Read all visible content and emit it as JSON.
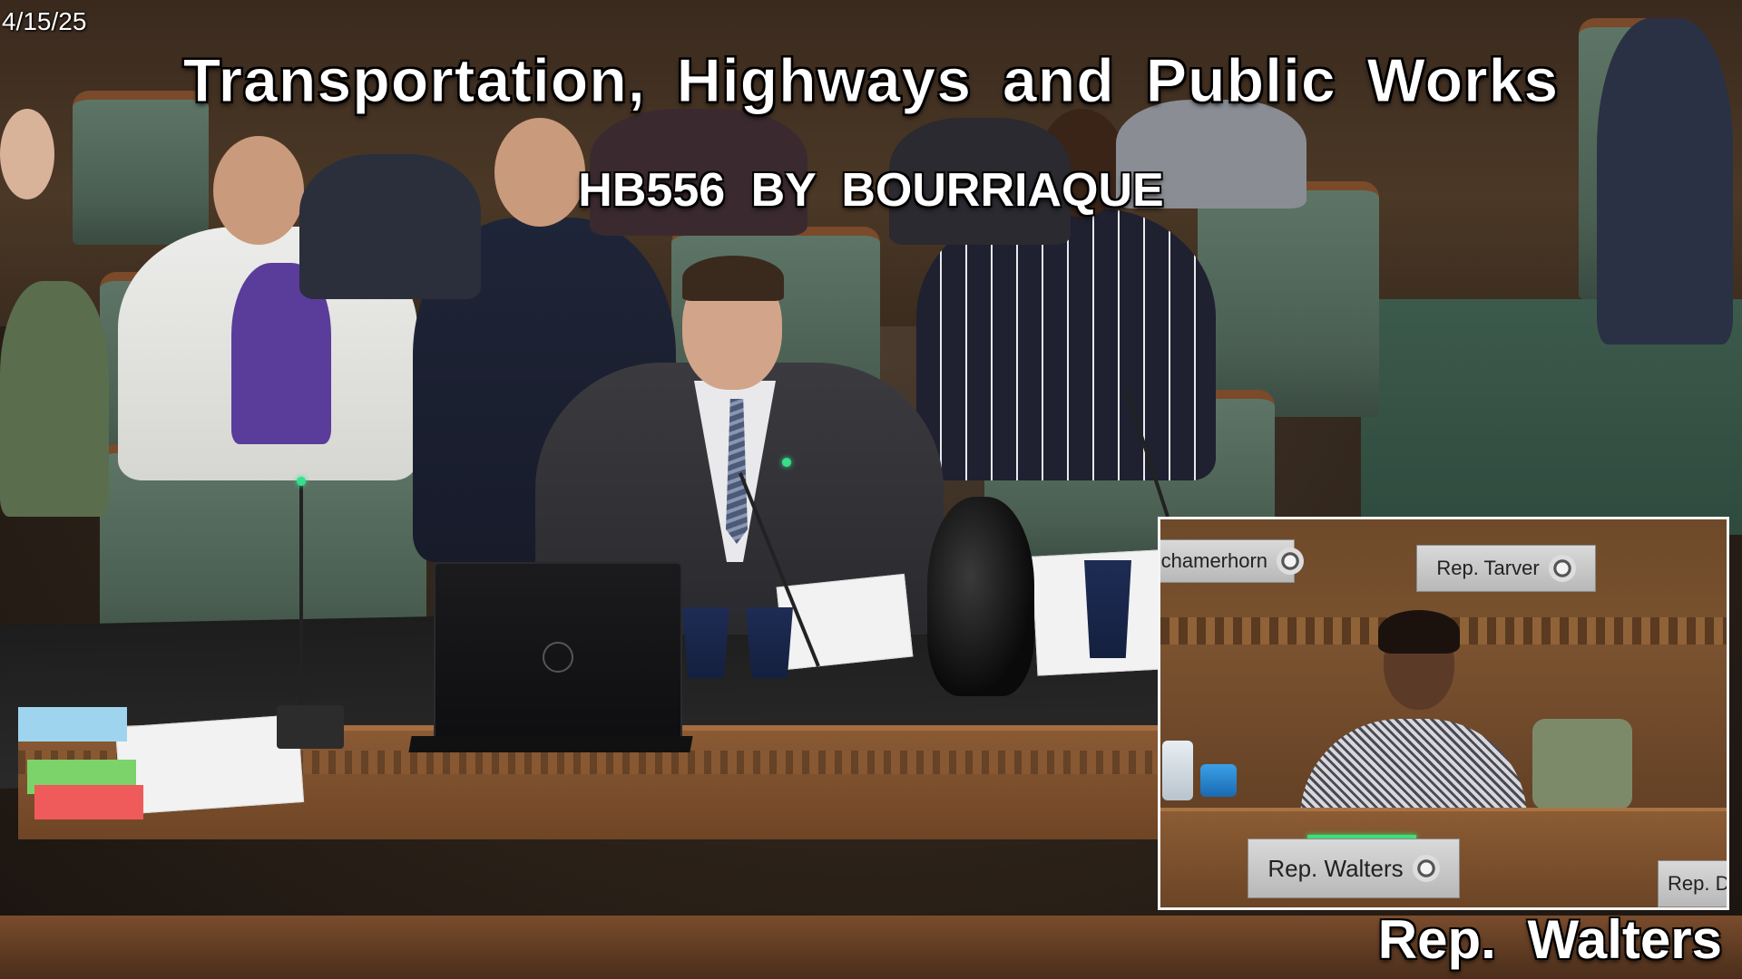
{
  "overlay": {
    "date": "4/15/25",
    "committee_title": "Transportation, Highways and Public Works",
    "bill": "HB556 BY BOURRIAQUE",
    "speaker_caption": "Rep. Walters"
  },
  "inset": {
    "nameplates": {
      "left": "Schamerhorn",
      "center": "Rep. Tarver",
      "bottom": "Rep. Walters",
      "right_partial": "Rep. D"
    }
  },
  "colors": {
    "mic_led": "#34e08a",
    "caption_text": "#ffffff",
    "inset_border": "#f4f4f4"
  }
}
